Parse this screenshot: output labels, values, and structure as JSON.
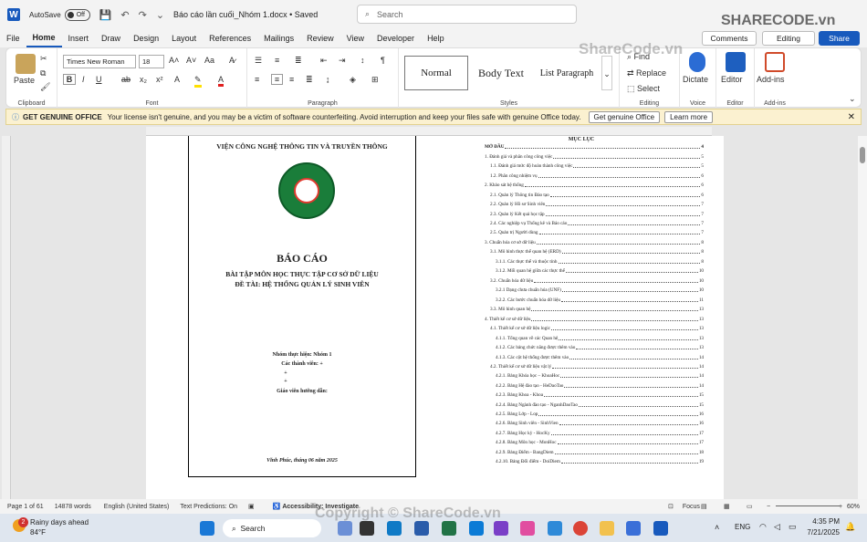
{
  "titlebar": {
    "app_logo": "W",
    "autosave_label": "AutoSave",
    "autosave_state": "Off",
    "doc_title": "Báo cáo lần cuối_Nhóm 1.docx • Saved",
    "search_placeholder": "Search"
  },
  "menu": {
    "tabs": [
      "File",
      "Home",
      "Insert",
      "Draw",
      "Design",
      "Layout",
      "References",
      "Mailings",
      "Review",
      "View",
      "Developer",
      "Help"
    ],
    "active": "Home",
    "comments_label": "Comments",
    "editing_label": "Editing",
    "share_label": "Share"
  },
  "ribbon": {
    "clipboard": {
      "paste_label": "Paste",
      "group_label": "Clipboard"
    },
    "font": {
      "font_name": "Times New Roman",
      "font_size": "18",
      "group_label": "Font",
      "bold": "B",
      "italic": "I",
      "underline": "U",
      "strike": "ab",
      "subscript": "x₂",
      "superscript": "x²"
    },
    "paragraph": {
      "group_label": "Paragraph"
    },
    "styles": {
      "items": [
        "Normal",
        "Body Text",
        "List Paragraph"
      ],
      "group_label": "Styles"
    },
    "editing": {
      "find": "Find",
      "replace": "Replace",
      "select": "Select",
      "group_label": "Editing"
    },
    "voice": {
      "dictate": "Dictate",
      "group_label": "Voice"
    },
    "editor": {
      "label": "Editor",
      "group_label": "Editor"
    },
    "addins": {
      "label": "Add-ins",
      "group_label": "Add-ins"
    }
  },
  "infobar": {
    "title": "GET GENUINE OFFICE",
    "message": "Your license isn't genuine, and you may be a victim of software counterfeiting. Avoid interruption and keep your files safe with genuine Office today.",
    "btn_get": "Get genuine Office",
    "btn_learn": "Learn more"
  },
  "cover": {
    "institute": "VIỆN CÔNG NGHỆ THÔNG TIN VÀ TRUYỀN THÔNG",
    "report": "BÁO CÁO",
    "subject": "BÀI TẬP MÔN HỌC THỰC TẬP CƠ SỞ DỮ LIỆU",
    "topic": "ĐỀ TÀI: HỆ THỐNG QUẢN LÝ SINH VIÊN",
    "group": "Nhóm thực hiện: Nhóm 1",
    "members": "Các thành viên: +",
    "plus1": "+",
    "plus2": "+",
    "teacher": "Giáo viên hướng dẫn:",
    "date": "Vĩnh Phúc, tháng 06 năm 2025"
  },
  "toc": {
    "title": "MỤC LỤC",
    "rows": [
      {
        "text": "MỞ ĐẦU",
        "page": "4"
      },
      {
        "text": "1. Đánh giá và phân công công việc",
        "page": "5"
      },
      {
        "text": "1.1.  Đánh giá mức độ hoàn thành công việc",
        "page": "5"
      },
      {
        "text": "1.2. Phân công nhiệm vụ",
        "page": "6"
      },
      {
        "text": "2. Khảo sát hệ thống",
        "page": "6"
      },
      {
        "text": "2.1. Quản lý Thông tin Đào tạo",
        "page": "6"
      },
      {
        "text": "2.2. Quản lý Hồ sơ Sinh viên",
        "page": "7"
      },
      {
        "text": "2.3. Quản lý Kết quả học tập",
        "page": "7"
      },
      {
        "text": "2.4. Các nghiệp vụ Thống kê và Báo cáo",
        "page": "7"
      },
      {
        "text": "2.5. Quản trị Người dùng",
        "page": "7"
      },
      {
        "text": "3. Chuẩn hóa cơ sở dữ liệu",
        "page": "8"
      },
      {
        "text": "3.1. Mô hình thực thể quan hệ (ERD)",
        "page": "8"
      },
      {
        "text": "3.1.1. Các thực thể và thuộc tính",
        "page": "8"
      },
      {
        "text": "3.1.2. Mối quan hệ giữa các thực thể",
        "page": "10"
      },
      {
        "text": "3.2. Chuẩn hóa dữ liệu",
        "page": "10"
      },
      {
        "text": "3.2.1 Dạng chưa chuẩn hóa (UNF)",
        "page": "10"
      },
      {
        "text": "3.2.2. Các bước chuẩn hóa dữ liệu",
        "page": "11"
      },
      {
        "text": "3.3. Mô hình quan hệ",
        "page": "13"
      },
      {
        "text": "4. Thiết kế cơ sở dữ liệu",
        "page": "13"
      },
      {
        "text": "4.1. Thiết kế cơ sở dữ liệu logic",
        "page": "13"
      },
      {
        "text": "4.1.1. Tổng quan về các Quan hệ",
        "page": "13"
      },
      {
        "text": "4.1.2. Các bảng chức năng được thêm vào",
        "page": "13"
      },
      {
        "text": "4.1.3. Các cột hệ thống được thêm vào",
        "page": "14"
      },
      {
        "text": "4.2. Thiết kế cơ sở dữ liệu vật lý",
        "page": "14"
      },
      {
        "text": "4.2.1. Bảng Khóa học – KhoaHoc",
        "page": "14"
      },
      {
        "text": "4.2.2. Bảng Hệ đào tạo - HeDaoTao",
        "page": "14"
      },
      {
        "text": "4.2.3. Bảng Khoa - Khoa",
        "page": "15"
      },
      {
        "text": "4.2.4. Bảng Ngành đào tạo - NganhDaoTao",
        "page": "15"
      },
      {
        "text": "4.2.5. Bảng Lớp - Lop",
        "page": "16"
      },
      {
        "text": "4.2.6. Bảng Sinh viên - SinhVien",
        "page": "16"
      },
      {
        "text": "4.2.7. Bảng Học kỳ - HocKy",
        "page": "17"
      },
      {
        "text": "4.2.8. Bảng Môn học - MonHoc",
        "page": "17"
      },
      {
        "text": "4.2.9. Bảng Điểm - BangDiem",
        "page": "18"
      },
      {
        "text": "4.2.10. Bảng Đổi điểm - DoiDiem",
        "page": "19"
      }
    ]
  },
  "status": {
    "page": "Page 1 of 61",
    "words": "14878 words",
    "language": "English (United States)",
    "predictions": "Text Predictions: On",
    "accessibility": "Accessibility: Investigate",
    "focus": "Focus",
    "zoom": "60%"
  },
  "taskbar": {
    "weather_badge": "2",
    "weather_text": "Rainy days ahead",
    "temperature": "84°F",
    "search_label": "Search",
    "lang": "ENG",
    "time": "4:35 PM",
    "date": "7/21/2025"
  },
  "watermark": {
    "logo": "SHARECODE.vn",
    "mid": "ShareCode.vn",
    "copyright": "Copyright © ShareCode.vn"
  },
  "colors": {
    "accent": "#185abd",
    "infobar_bg": "#fbf1d0"
  }
}
